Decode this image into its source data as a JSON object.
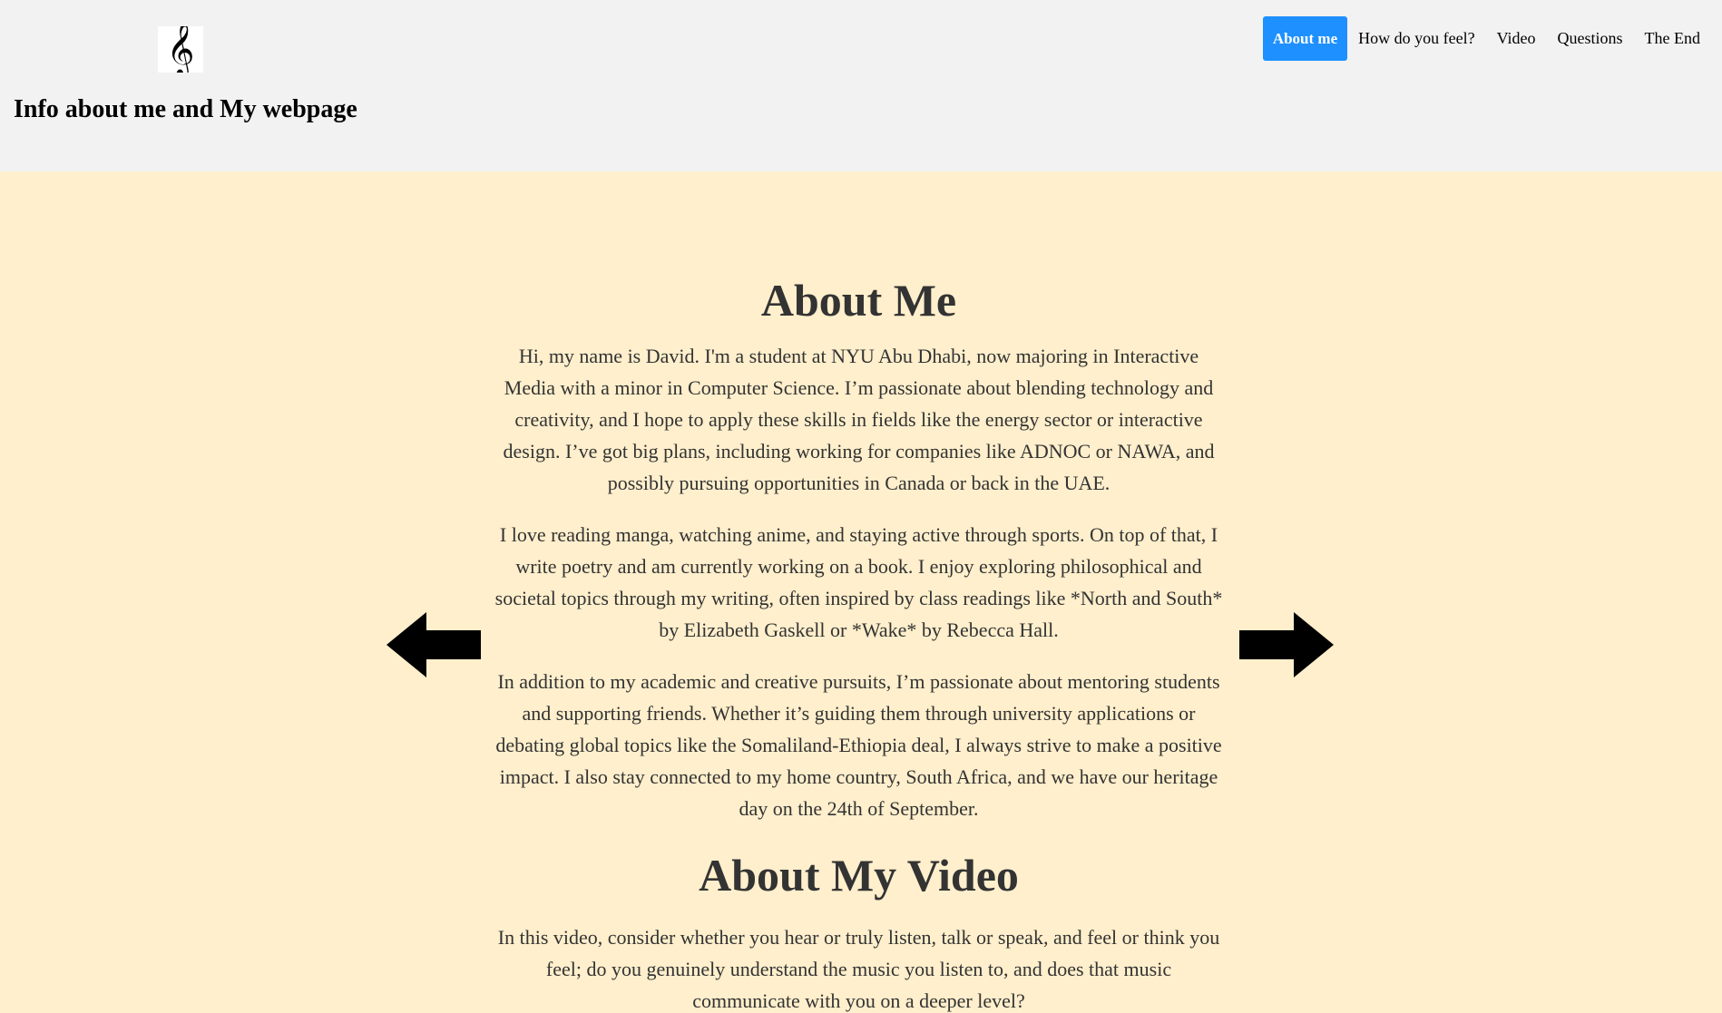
{
  "header": {
    "logo_icon": "treble-clef-icon",
    "logo_glyph": "𝄞",
    "title": "Info about me and My webpage"
  },
  "nav": {
    "items": [
      {
        "label": "About me",
        "active": true
      },
      {
        "label": "How do you feel?",
        "active": false
      },
      {
        "label": "Video",
        "active": false
      },
      {
        "label": "Questions",
        "active": false
      },
      {
        "label": "The End",
        "active": false
      }
    ]
  },
  "main": {
    "about_title": "About Me",
    "about_paragraphs": [
      "Hi, my name is David. I'm a student at NYU Abu Dhabi, now majoring in Interactive Media with a minor in Computer Science. I’m passionate about blending technology and creativity, and I hope to apply these skills in fields like the energy sector or interactive design. I’ve got big plans, including working for companies like ADNOC or NAWA, and possibly pursuing opportunities in Canada or back in the UAE.",
      "I love reading manga, watching anime, and staying active through sports. On top of that, I write poetry and am currently working on a book. I enjoy exploring philosophical and societal topics through my writing, often inspired by class readings like *North and South* by Elizabeth Gaskell or *Wake* by Rebecca Hall.",
      "In addition to my academic and creative pursuits, I’m passionate about mentoring students and supporting friends. Whether it’s guiding them through university applications or debating global topics like the Somaliland-Ethiopia deal, I always strive to make a positive impact. I also stay connected to my home country, South Africa, and we have our heritage day on the 24th of September."
    ],
    "video_title": "About My Video",
    "video_paragraphs": [
      "In this video, consider whether you hear or truly listen, talk or speak, and feel or think you feel; do you genuinely understand the music you listen to, and does that music communicate with you on a deeper level?"
    ]
  },
  "controls": {
    "prev_icon": "arrow-left-icon",
    "next_icon": "arrow-right-icon"
  },
  "colors": {
    "header_bg": "#f2f2f2",
    "main_bg": "#ffefcc",
    "accent": "#1e90ff",
    "text": "#333333"
  }
}
